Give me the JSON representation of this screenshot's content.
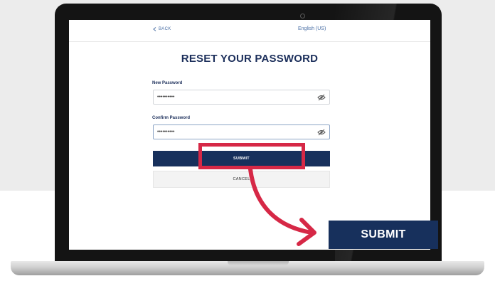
{
  "header": {
    "back_icon": "chevron-left-icon",
    "back_label": "BACK",
    "language_label": "English (US)"
  },
  "form": {
    "title": "RESET YOUR PASSWORD",
    "new_password": {
      "label": "New Password",
      "value": "••••••••••",
      "toggle_icon": "eye-slash-icon"
    },
    "confirm_password": {
      "label": "Confirm Password",
      "value": "••••••••••",
      "toggle_icon": "eye-slash-icon"
    },
    "submit_label": "SUBMIT",
    "cancel_label": "CANCEL"
  },
  "callout": {
    "label": "SUBMIT",
    "highlight_color": "#d62846",
    "arrow_color": "#d62846"
  },
  "colors": {
    "brand_navy": "#17305c",
    "title_navy": "#1c2f5b",
    "link_blue": "#4a6fa5"
  }
}
